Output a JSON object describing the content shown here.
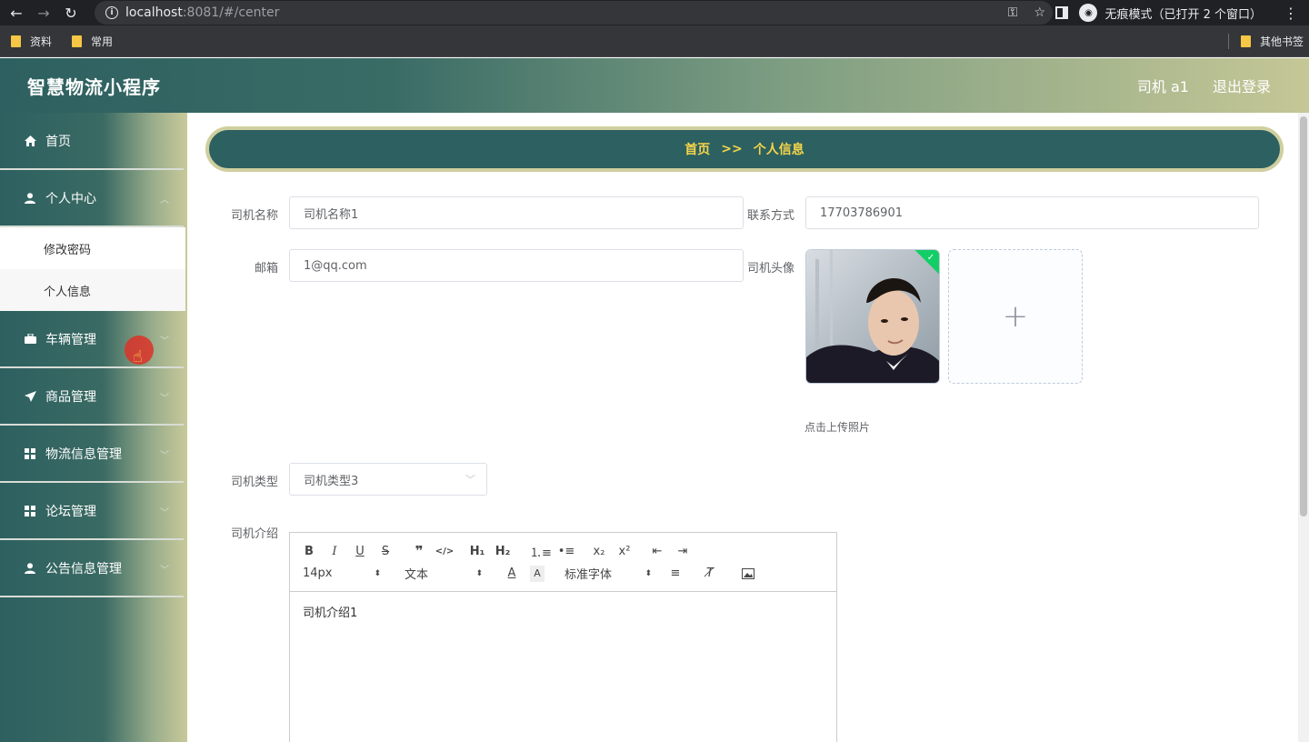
{
  "browser": {
    "url_host": "localhost",
    "url_path": ":8081/#/center",
    "incognito_label": "无痕模式（已打开 2 个窗口）",
    "bookmarks": [
      "资料",
      "常用"
    ],
    "other_bookmarks": "其他书签"
  },
  "header": {
    "app_title": "智慧物流小程序",
    "user_label": "司机 a1",
    "logout_label": "退出登录"
  },
  "sidebar": {
    "items": [
      {
        "label": "首页",
        "icon": "home-icon"
      },
      {
        "label": "个人中心",
        "icon": "user-icon",
        "expanded": true,
        "children": [
          "修改密码",
          "个人信息"
        ]
      },
      {
        "label": "车辆管理",
        "icon": "briefcase-icon"
      },
      {
        "label": "商品管理",
        "icon": "send-icon"
      },
      {
        "label": "物流信息管理",
        "icon": "grid-icon"
      },
      {
        "label": "论坛管理",
        "icon": "grid-icon"
      },
      {
        "label": "公告信息管理",
        "icon": "user-icon"
      }
    ]
  },
  "breadcrumb": {
    "home": "首页",
    "separator": ">>",
    "current": "个人信息"
  },
  "form": {
    "driver_name_label": "司机名称",
    "driver_name_value": "司机名称1",
    "contact_label": "联系方式",
    "contact_value": "17703786901",
    "email_label": "邮箱",
    "email_value": "1@qq.com",
    "avatar_label": "司机头像",
    "upload_tip": "点击上传照片",
    "driver_type_label": "司机类型",
    "driver_type_value": "司机类型3",
    "intro_label": "司机介绍",
    "intro_value": "司机介绍1"
  },
  "editor": {
    "font_size": "14px",
    "text_style": "文本",
    "font_family": "标准字体"
  },
  "colors": {
    "header_start": "#2d6060",
    "header_end": "#c5c796",
    "breadcrumb_bg": "#2d6060",
    "breadcrumb_text": "#f5d54a",
    "success_badge": "#13ce66"
  }
}
